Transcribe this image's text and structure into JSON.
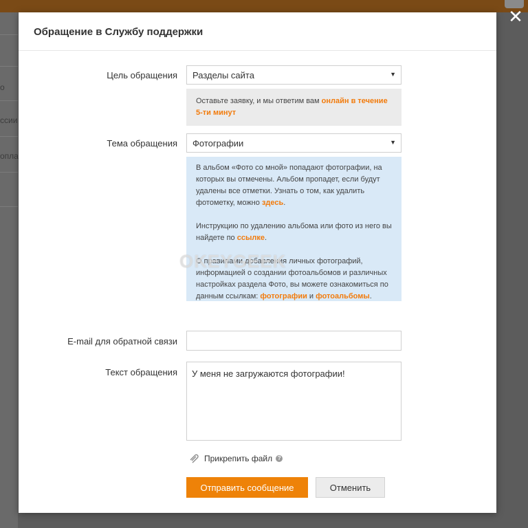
{
  "modal": {
    "title": "Обращение в Службу поддержки",
    "purpose": {
      "label": "Цель обращения",
      "selected": "Разделы сайта",
      "note_text": "Оставьте заявку, и мы ответим вам ",
      "note_highlight": "онлайн в течение 5-ти минут"
    },
    "topic": {
      "label": "Тема обращения",
      "selected": "Фотографии",
      "info_p1_text": "В альбом «Фото со мной» попадают фотографии, на которых вы отмечены. Альбом пропадет, если будут удалены все отметки. Узнать о том, как удалить фотометку, можно ",
      "info_p1_link": "здесь",
      "info_p1_end": ".",
      "info_p2_text": "Инструкцию по удалению альбома или фото из него вы найдете по ",
      "info_p2_link": "ссылке",
      "info_p2_end": ".",
      "info_p3_text": "О правилами добавления личных фотографий, информацией о создании фотоальбомов и различных настройках раздела Фото, вы можете ознакомиться по данным ссылкам: ",
      "info_p3_link1": "фотографии",
      "info_p3_and": " и ",
      "info_p3_link2": "фотоальбомы",
      "info_p3_end": "."
    },
    "email": {
      "label": "E-mail для обратной связи",
      "value": ""
    },
    "message": {
      "label": "Текст обращения",
      "value": "У меня не загружаются фотографии!"
    },
    "attach_label": "Прикрепить файл",
    "help_glyph": "?",
    "submit_label": "Отправить сообщение",
    "cancel_label": "Отменить"
  },
  "watermark": "OKEYGEEK",
  "close_glyph": "✕",
  "dropdown_glyph": "▼",
  "background": {
    "left_fragments": [
      "о",
      "ссии",
      "опла"
    ]
  },
  "colors": {
    "accent": "#ee8208",
    "link": "#f27b0c",
    "info_bg": "#d9e9f7",
    "note_bg": "#ebebeb"
  }
}
